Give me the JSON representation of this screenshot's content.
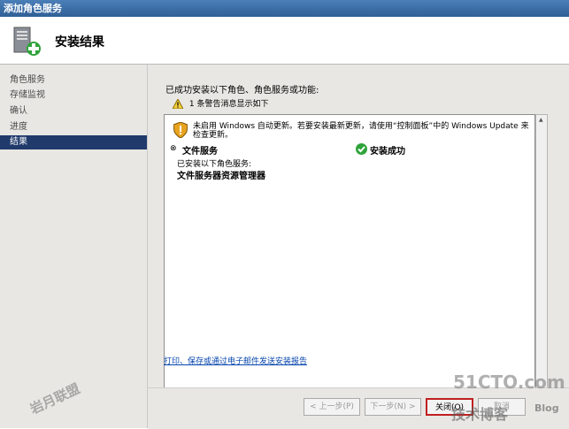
{
  "window": {
    "title": "添加角色服务"
  },
  "header": {
    "title": "安装结果"
  },
  "sidebar": {
    "items": [
      {
        "label": "角色服务"
      },
      {
        "label": "存储监视"
      },
      {
        "label": "确认"
      },
      {
        "label": "进度"
      },
      {
        "label": "结果"
      }
    ],
    "active_index": 4
  },
  "main": {
    "intro": "已成功安装以下角色、角色服务或功能:",
    "warning_summary": "1 条警告消息显示如下",
    "notice": "未启用 Windows 自动更新。若要安装最新更新，请使用“控制面板”中的 Windows Update 来检查更新。",
    "role": {
      "name": "文件服务",
      "status": "安装成功",
      "installed_label": "已安装以下角色服务:",
      "installed_item": "文件服务器资源管理器"
    },
    "report_link": "打印、保存或通过电子邮件发送安装报告"
  },
  "buttons": {
    "prev": "< 上一步(P)",
    "next": "下一步(N) >",
    "close": "关闭(O)",
    "cancel": "取消"
  },
  "watermarks": {
    "left": "岩月联盟",
    "right_top": "51CTO.com",
    "right_bottom": "技术博客",
    "right_blog": "Blog"
  },
  "colors": {
    "titlebar": "#2f5f96",
    "sidebar_active": "#1f3a6b",
    "link": "#0645ad",
    "highlight_border": "#c02020"
  }
}
